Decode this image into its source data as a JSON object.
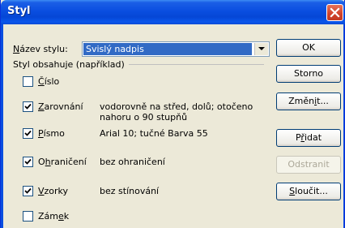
{
  "window": {
    "title": "Styl"
  },
  "style_name": {
    "label_prefix": "N",
    "label_rest": "ázev stylu:",
    "value": "Svislý nadpis"
  },
  "group": {
    "label": "Styl obsahuje (například)"
  },
  "options": [
    {
      "id": "cislo",
      "label_prefix": "Č",
      "label_rest": "íslo",
      "checked": false,
      "description": ""
    },
    {
      "id": "zarovnani",
      "label_prefix": "Z",
      "label_rest": "arovnání",
      "checked": true,
      "description": "vodorovně na střed, dolů; otočeno nahoru o 90 stupňů",
      "description_line1": "vodorovně na střed, dolů; otočeno",
      "description_line2": "nahoru o 90 stupňů"
    },
    {
      "id": "pismo",
      "label_prefix": "P",
      "label_rest": "ísmo",
      "checked": true,
      "description": "Arial 10; tučné Barva 55"
    },
    {
      "id": "ohraniceni",
      "label_pre": "O",
      "label_mid": "h",
      "label_rest": "raničení",
      "checked": true,
      "description": "bez ohraničení"
    },
    {
      "id": "vzorky",
      "label_prefix": "V",
      "label_rest": "zorky",
      "checked": true,
      "description": "bez stínování"
    },
    {
      "id": "zamek",
      "label_pre": "Zám",
      "label_mid": "e",
      "label_rest": "k",
      "checked": false,
      "description": ""
    }
  ],
  "buttons": {
    "ok": "OK",
    "storno": "Storno",
    "zmenit_pre": "Změn",
    "zmenit_mid": "i",
    "zmenit_rest": "t...",
    "pridat_pre": "P",
    "pridat_mid": "ř",
    "pridat_rest": "idat",
    "odstranit": "Odstranit",
    "sloucit_pre": "S",
    "sloucit_rest": "loučit..."
  },
  "colors": {
    "title_bar": "#0a4ee0",
    "selection": "#316ac5",
    "dialog_bg": "#ece9d8",
    "close": "#d0412a"
  }
}
